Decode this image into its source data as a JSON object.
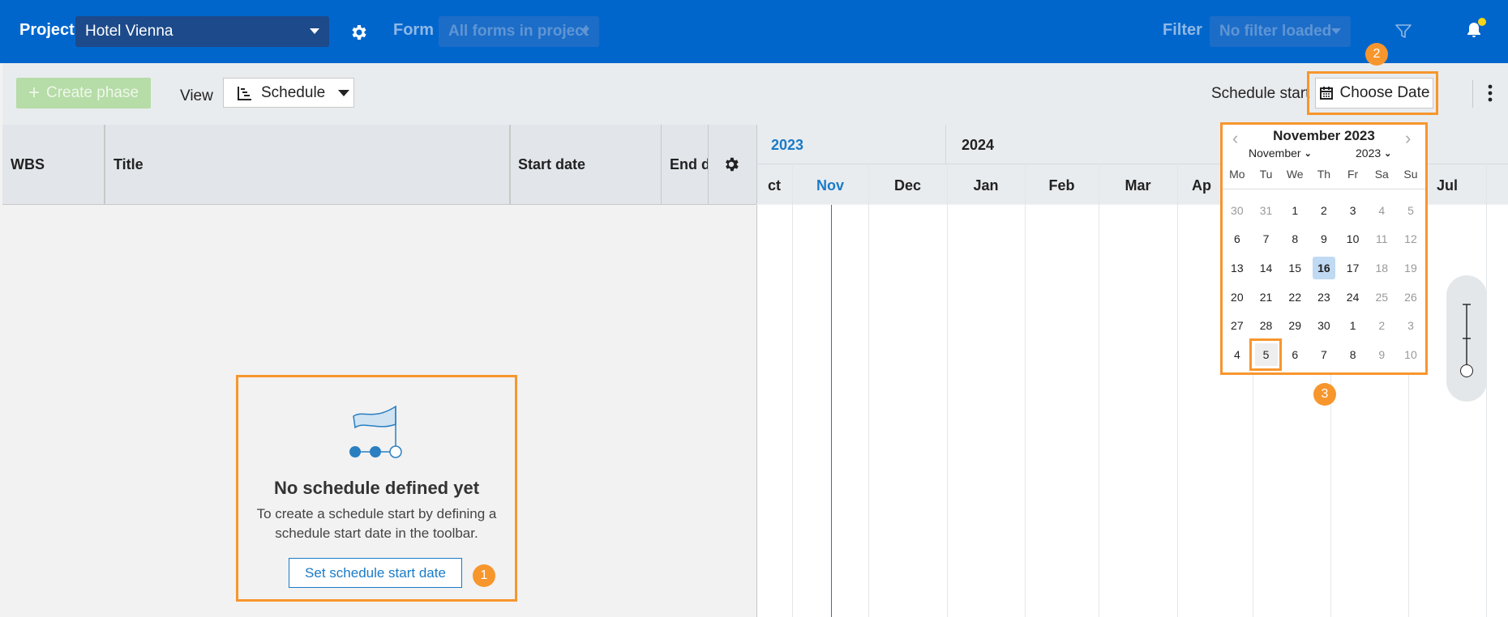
{
  "topbar": {
    "project_label": "Project",
    "project_value": "Hotel Vienna",
    "form_label": "Form",
    "form_value": "All forms in project",
    "filter_label": "Filter",
    "filter_value": "No filter loaded"
  },
  "toolbar": {
    "create_phase": "Create phase",
    "view_label": "View",
    "view_value": "Schedule",
    "schedule_start_label": "Schedule start",
    "choose_date": "Choose Date"
  },
  "grid": {
    "columns": [
      "WBS",
      "Title",
      "Start date",
      "End da"
    ]
  },
  "timeline": {
    "years": [
      "2023",
      "2024"
    ],
    "months": [
      "ct",
      "Nov",
      "Dec",
      "Jan",
      "Feb",
      "Mar",
      "Ap",
      "Jul"
    ]
  },
  "empty_state": {
    "title": "No schedule defined yet",
    "description": "To create a schedule start by defining a schedule start date in the toolbar.",
    "button": "Set schedule start date"
  },
  "badges": [
    "1",
    "2",
    "3"
  ],
  "calendar": {
    "title": "November 2023",
    "month_select": "November",
    "year_select": "2023",
    "weekdays": [
      "Mo",
      "Tu",
      "We",
      "Th",
      "Fr",
      "Sa",
      "Su"
    ],
    "days": [
      {
        "d": "30",
        "other": true
      },
      {
        "d": "31",
        "other": true
      },
      {
        "d": "1"
      },
      {
        "d": "2"
      },
      {
        "d": "3"
      },
      {
        "d": "4",
        "weekend": true
      },
      {
        "d": "5",
        "weekend": true
      },
      {
        "d": "6"
      },
      {
        "d": "7"
      },
      {
        "d": "8"
      },
      {
        "d": "9"
      },
      {
        "d": "10"
      },
      {
        "d": "11",
        "weekend": true
      },
      {
        "d": "12",
        "weekend": true
      },
      {
        "d": "13"
      },
      {
        "d": "14"
      },
      {
        "d": "15"
      },
      {
        "d": "16",
        "today": true
      },
      {
        "d": "17"
      },
      {
        "d": "18",
        "weekend": true
      },
      {
        "d": "19",
        "weekend": true
      },
      {
        "d": "20"
      },
      {
        "d": "21"
      },
      {
        "d": "22"
      },
      {
        "d": "23"
      },
      {
        "d": "24"
      },
      {
        "d": "25",
        "weekend": true
      },
      {
        "d": "26",
        "weekend": true
      },
      {
        "d": "27"
      },
      {
        "d": "28"
      },
      {
        "d": "29"
      },
      {
        "d": "30"
      },
      {
        "d": "1"
      },
      {
        "d": "2",
        "weekend": true
      },
      {
        "d": "3",
        "weekend": true
      },
      {
        "d": "4"
      },
      {
        "d": "5",
        "selected": true
      },
      {
        "d": "6"
      },
      {
        "d": "7"
      },
      {
        "d": "8"
      },
      {
        "d": "9",
        "weekend": true
      },
      {
        "d": "10",
        "weekend": true
      }
    ]
  },
  "colors": {
    "brand_blue": "#0066cc",
    "highlight_orange": "#f7962d",
    "link_blue": "#1a7bc8"
  }
}
